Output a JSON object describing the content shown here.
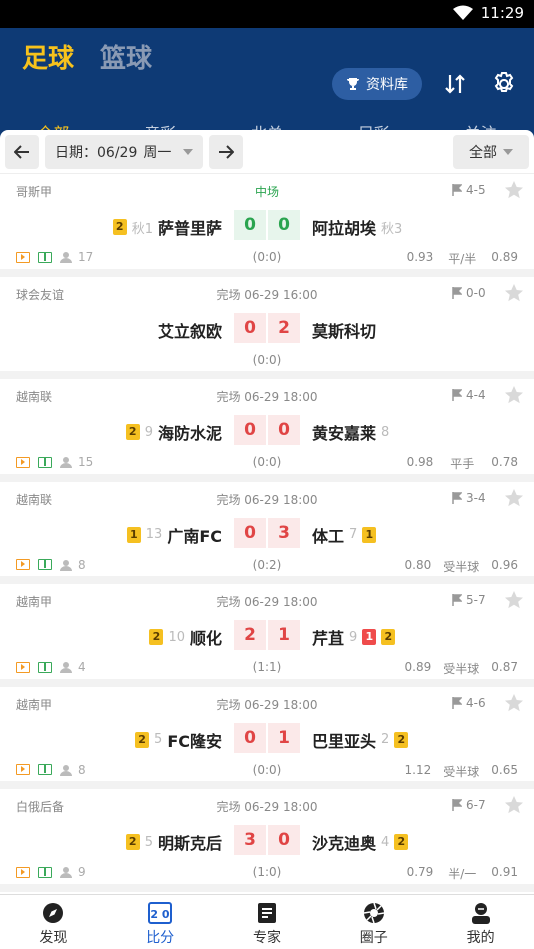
{
  "statusbar": {
    "time": "11:29"
  },
  "header": {
    "sport_tabs": [
      {
        "label": "足球",
        "active": true
      },
      {
        "label": "篮球",
        "active": false
      }
    ],
    "database_button": "资料库",
    "sub_tabs": [
      {
        "label": "全部",
        "active": true
      },
      {
        "label": "竞彩",
        "active": false
      },
      {
        "label": "北单",
        "active": false
      },
      {
        "label": "足彩",
        "active": false
      },
      {
        "label": "关注",
        "active": false
      }
    ]
  },
  "filter": {
    "date_label": "日期：06/29",
    "weekday": "周一",
    "scope": "全部"
  },
  "matches": [
    {
      "league": "哥斯甲",
      "status": "中场",
      "live": true,
      "corner": "4-5",
      "home": {
        "name": "萨普里萨",
        "rank": "秋1",
        "cards": [
          {
            "type": "y",
            "n": "2"
          }
        ]
      },
      "away": {
        "name": "阿拉胡埃",
        "rank": "秋3",
        "cards": []
      },
      "score_home": "0",
      "score_away": "0",
      "half": "(0:0)",
      "icons": true,
      "users": "17",
      "odds": {
        "left": "0.93",
        "mid": "平/半",
        "right": "0.89"
      }
    },
    {
      "league": "球会友谊",
      "status": "完场 06-29 16:00",
      "live": false,
      "corner": "0-0",
      "home": {
        "name": "艾立叙欧",
        "rank": "",
        "cards": []
      },
      "away": {
        "name": "莫斯科切",
        "rank": "",
        "cards": []
      },
      "score_home": "0",
      "score_away": "2",
      "half": "(0:0)",
      "icons": false,
      "users": "",
      "odds": {
        "left": "",
        "mid": "",
        "right": ""
      }
    },
    {
      "league": "越南联",
      "status": "完场 06-29 18:00",
      "live": false,
      "corner": "4-4",
      "home": {
        "name": "海防水泥",
        "rank": "9",
        "cards": [
          {
            "type": "y",
            "n": "2"
          }
        ]
      },
      "away": {
        "name": "黄安嘉莱",
        "rank": "8",
        "cards": []
      },
      "score_home": "0",
      "score_away": "0",
      "half": "(0:0)",
      "icons": true,
      "users": "15",
      "odds": {
        "left": "0.98",
        "mid": "平手",
        "right": "0.78"
      }
    },
    {
      "league": "越南联",
      "status": "完场 06-29 18:00",
      "live": false,
      "corner": "3-4",
      "home": {
        "name": "广南FC",
        "rank": "13",
        "cards": [
          {
            "type": "y",
            "n": "1"
          }
        ]
      },
      "away": {
        "name": "体工",
        "rank": "7",
        "cards": [
          {
            "type": "y",
            "n": "1"
          }
        ]
      },
      "score_home": "0",
      "score_away": "3",
      "half": "(0:2)",
      "icons": true,
      "users": "8",
      "odds": {
        "left": "0.80",
        "mid": "受半球",
        "right": "0.96"
      }
    },
    {
      "league": "越南甲",
      "status": "完场 06-29 18:00",
      "live": false,
      "corner": "5-7",
      "home": {
        "name": "顺化",
        "rank": "10",
        "cards": [
          {
            "type": "y",
            "n": "2"
          }
        ]
      },
      "away": {
        "name": "芹苴",
        "rank": "9",
        "cards": [
          {
            "type": "r",
            "n": "1"
          },
          {
            "type": "y",
            "n": "2"
          }
        ]
      },
      "score_home": "2",
      "score_away": "1",
      "half": "(1:1)",
      "icons": true,
      "users": "4",
      "odds": {
        "left": "0.89",
        "mid": "受半球",
        "right": "0.87"
      }
    },
    {
      "league": "越南甲",
      "status": "完场 06-29 18:00",
      "live": false,
      "corner": "4-6",
      "home": {
        "name": "FC隆安",
        "rank": "5",
        "cards": [
          {
            "type": "y",
            "n": "2"
          }
        ]
      },
      "away": {
        "name": "巴里亚头",
        "rank": "2",
        "cards": [
          {
            "type": "y",
            "n": "2"
          }
        ]
      },
      "score_home": "0",
      "score_away": "1",
      "half": "(0:0)",
      "icons": true,
      "users": "8",
      "odds": {
        "left": "1.12",
        "mid": "受半球",
        "right": "0.65"
      }
    },
    {
      "league": "白俄后备",
      "status": "完场 06-29 18:00",
      "live": false,
      "corner": "6-7",
      "home": {
        "name": "明斯克后",
        "rank": "5",
        "cards": [
          {
            "type": "y",
            "n": "2"
          }
        ]
      },
      "away": {
        "name": "沙克迪奥",
        "rank": "4",
        "cards": [
          {
            "type": "y",
            "n": "2"
          }
        ]
      },
      "score_home": "3",
      "score_away": "0",
      "half": "(1:0)",
      "icons": true,
      "users": "9",
      "odds": {
        "left": "0.79",
        "mid": "半/一",
        "right": "0.91"
      }
    }
  ],
  "tabbar": [
    {
      "label": "发现",
      "icon": "compass-icon",
      "active": false
    },
    {
      "label": "比分",
      "icon": "scoreboard-icon",
      "active": true
    },
    {
      "label": "专家",
      "icon": "document-icon",
      "active": false
    },
    {
      "label": "圈子",
      "icon": "aperture-icon",
      "active": false
    },
    {
      "label": "我的",
      "icon": "profile-icon",
      "active": false
    }
  ],
  "colors": {
    "header": "#0e3a75",
    "accent": "#f7c21c",
    "live": "#2aa44f",
    "score": "#e04545",
    "tab_active": "#1e5fce"
  }
}
